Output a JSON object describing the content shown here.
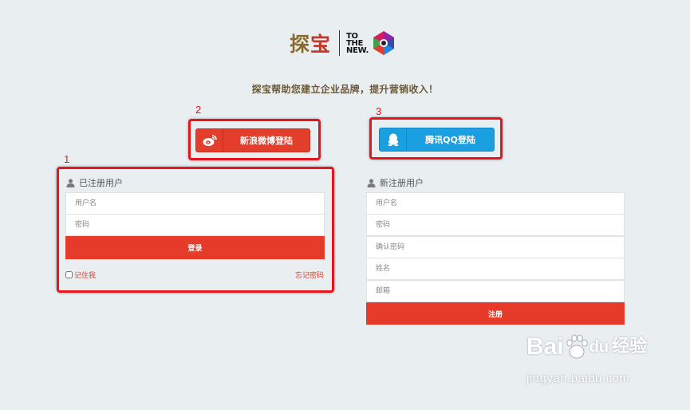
{
  "logo": {
    "brand_a": "探",
    "brand_b": "宝",
    "partner_line1": "TO",
    "partner_line2": "THE",
    "partner_line3": "NEW."
  },
  "tagline": "探宝帮助您建立企业品牌，提升营销收入！",
  "social": {
    "weibo_label": "新浪微博登陆",
    "qq_label": "腾讯QQ登陆"
  },
  "login": {
    "heading": "已注册用户",
    "username_placeholder": "用户名",
    "password_placeholder": "密码",
    "submit_label": "登录",
    "remember_label": "记住我",
    "forgot_label": "忘记密码"
  },
  "register": {
    "heading": "新注册用户",
    "username_placeholder": "用户名",
    "password_placeholder": "密码",
    "confirm_placeholder": "确认密码",
    "name_placeholder": "姓名",
    "email_placeholder": "邮箱",
    "submit_label": "注册"
  },
  "annotations": {
    "one": "1",
    "two": "2",
    "three": "3"
  },
  "watermark": {
    "line1_a": "Bai",
    "line1_b": "du",
    "line1_c": "经验",
    "line2": "jingyan.baidu.com"
  },
  "colors": {
    "primary_red": "#e63a2b",
    "qq_blue": "#1aa0e0",
    "annotation_red": "#e8141c",
    "background": "#e9eff1"
  }
}
